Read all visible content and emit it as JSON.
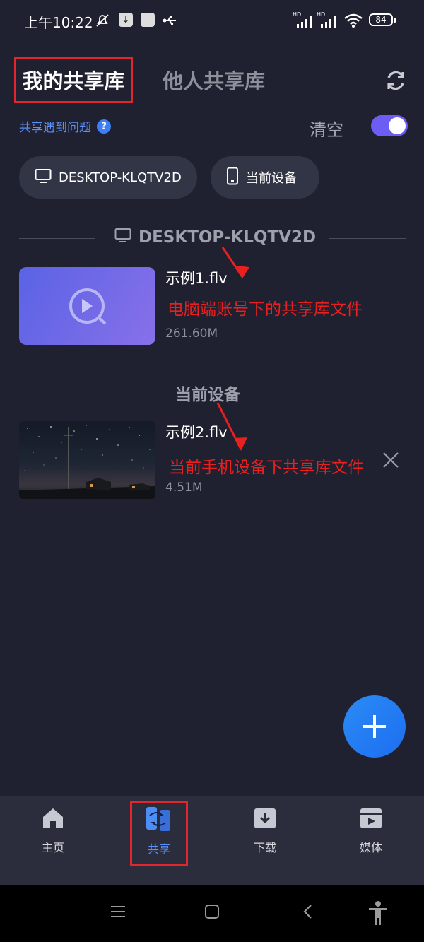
{
  "status_bar": {
    "time": "上午10:22",
    "hd1": "HD",
    "hd2": "HD",
    "battery": "84"
  },
  "header": {
    "tab_mine": "我的共享库",
    "tab_others": "他人共享库"
  },
  "controls": {
    "help_link": "共享遇到问题",
    "help_icon": "?",
    "clear_label": "清空",
    "toggle_on": true
  },
  "chips": [
    {
      "label": "DESKTOP-KLQTV2D",
      "icon": "monitor-icon"
    },
    {
      "label": "当前设备",
      "icon": "phone-icon"
    }
  ],
  "sections": [
    {
      "title": "DESKTOP-KLQTV2D",
      "file": {
        "name": "示例1.flv",
        "size": "261.60M"
      },
      "annotation": "电脑端账号下的共享库文件"
    },
    {
      "title": "当前设备",
      "file": {
        "name": "示例2.flv",
        "size": "4.51M"
      },
      "annotation": "当前手机设备下共享库文件"
    }
  ],
  "bottom_nav": {
    "items": [
      {
        "label": "主页",
        "icon": "home-icon"
      },
      {
        "label": "共享",
        "icon": "share-icon"
      },
      {
        "label": "下载",
        "icon": "download-icon"
      },
      {
        "label": "媒体",
        "icon": "media-icon"
      }
    ]
  },
  "colors": {
    "background": "#1f2130",
    "accent": "#6d5df4",
    "annotation_red": "#e8201f",
    "link_blue": "#5d8ff6"
  }
}
